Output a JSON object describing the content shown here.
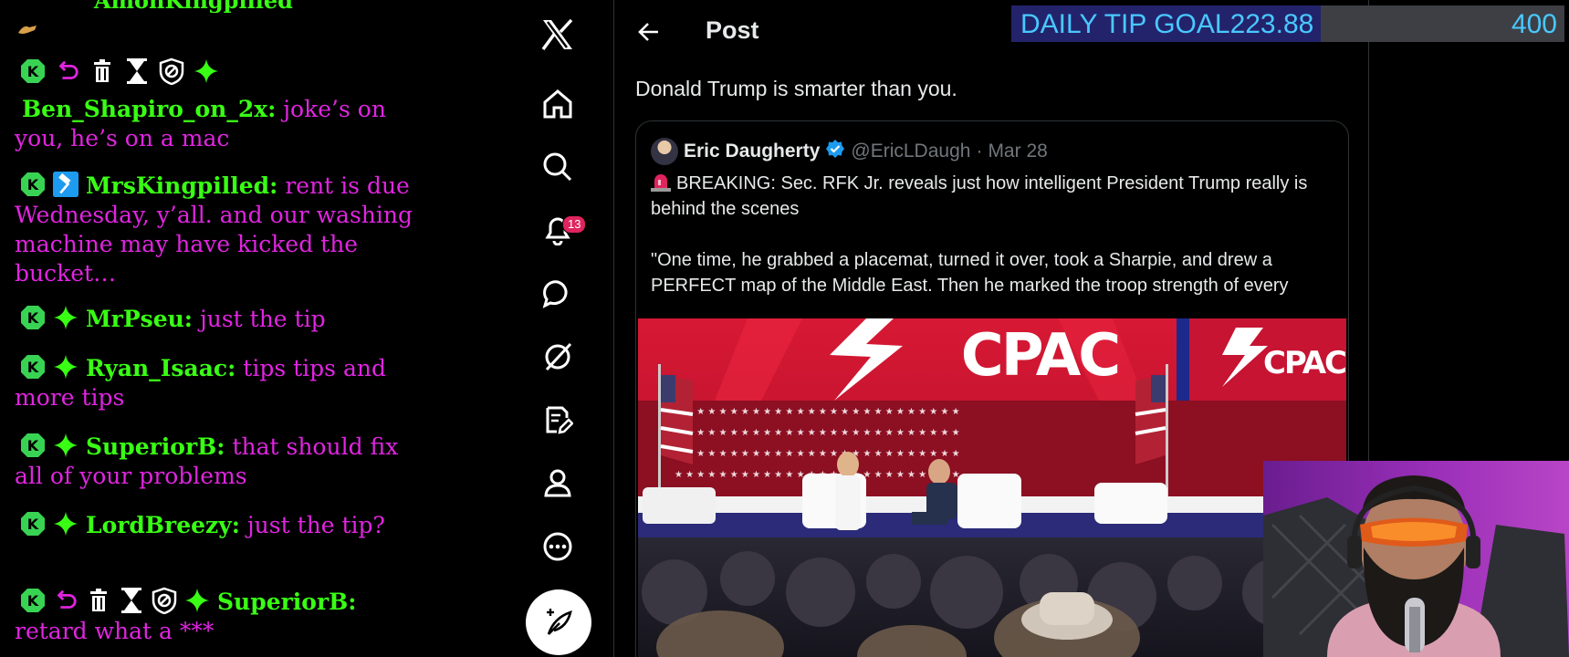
{
  "chat": {
    "partial_top_name": "AmonKingpilled",
    "messages": [
      {
        "user": "Ben_Shapiro_on_2x:",
        "text": " joke’s on you, he’s on a mac"
      },
      {
        "user": "MrsKingpilled:",
        "text": " rent is due Wednesday, y’all. and our washing machine may have kicked the bucket…"
      },
      {
        "user": "MrPseu:",
        "text": " just the tip"
      },
      {
        "user": "Ryan_Isaac:",
        "text": " tips tips and more tips"
      },
      {
        "user": "SuperiorB:",
        "text": " that should fix all of your problems"
      },
      {
        "user": "LordBreezy:",
        "text": " just the tip?"
      },
      {
        "user": "SuperiorB:",
        "text": " retard what a ***"
      }
    ]
  },
  "rail": {
    "notifications_count": "13",
    "icons": [
      "x-logo-icon",
      "home-icon",
      "search-icon",
      "bell-icon",
      "message-icon",
      "grok-icon",
      "edit-icon",
      "profile-icon",
      "more-icon",
      "post-feather-icon"
    ]
  },
  "header": {
    "title": "Post"
  },
  "post": {
    "text": "Donald Trump is smarter than you."
  },
  "quote": {
    "name": "Eric Daugherty",
    "handle": "@EricLDaugh",
    "separator": "·",
    "date": "Mar 28",
    "para1": "BREAKING: Sec. RFK Jr. reveals just how intelligent President Trump really is behind the scenes",
    "para2": "\"One time, he grabbed a placemat, turned it over, took a Sharpie, and drew a PERFECT map of the Middle East. Then he marked the troop strength of every"
  },
  "media": {
    "brand_text": "CPAC"
  },
  "tip_goal": {
    "label": "DAILY TIP GOAL",
    "current": "223.88",
    "target": "400",
    "progress": 0.5597
  },
  "colors": {
    "chat_name": "#39ff14",
    "chat_text": "#e025e0",
    "x_blue": "#1d9bf0",
    "tip_text": "#49c8ff",
    "notif_red": "#e0245e"
  }
}
